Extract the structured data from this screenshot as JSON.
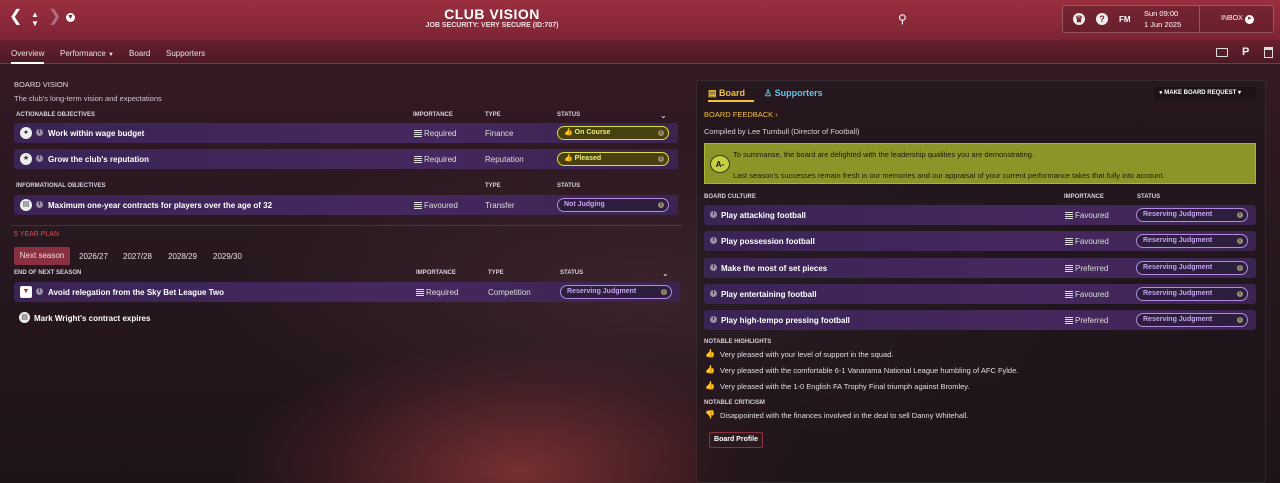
{
  "header": {
    "title": "CLUB VISION",
    "subtitle": "JOB SECURITY: VERY SECURE (ID:707)",
    "date": "Sun 09:00",
    "date2": "1 Jun 2025",
    "fm": "FM",
    "help": "?",
    "inbox": "INBOX"
  },
  "tabs": [
    "Overview",
    "Performance",
    "Board",
    "Supporters"
  ],
  "vision": {
    "heading": "BOARD VISION",
    "desc": "The club's long-term vision and expectations",
    "actionable": "ACTIONABLE OBJECTIVES",
    "informational": "INFORMATIONAL OBJECTIVES",
    "col_importance": "IMPORTANCE",
    "col_type": "TYPE",
    "col_status": "STATUS"
  },
  "actionable": [
    {
      "name": "Work within wage budget",
      "importance": "Required",
      "type": "Finance",
      "status": "On Course"
    },
    {
      "name": "Grow the club's reputation",
      "importance": "Required",
      "type": "Reputation",
      "status": "Pleased"
    }
  ],
  "informational": [
    {
      "name": "Maximum one-year contracts for players over the age of 32",
      "importance": "Favoured",
      "type": "Transfer",
      "status": "Not Judging"
    }
  ],
  "plan": {
    "heading": "5 YEAR PLAN",
    "years": [
      "Next season",
      "2026/27",
      "2027/28",
      "2028/29",
      "2029/30"
    ],
    "sub": "END OF NEXT SEASON",
    "item": {
      "name": "Avoid relegation from the Sky Bet League Two",
      "importance": "Required",
      "type": "Competition",
      "status": "Reserving Judgment"
    },
    "note": "Mark Wright's contract expires"
  },
  "right": {
    "tab_board": "Board",
    "tab_supporters": "Supporters",
    "request": "MAKE BOARD REQUEST",
    "feedback": "BOARD FEEDBACK",
    "compiled": "Compiled by Lee Turnbull (Director of Football)",
    "grade": "A-",
    "summary1": "To summarise, the board are delighted with the leadership qualities you are demonstrating.",
    "summary2": "Last season's successes remain fresh in our memories and our appraisal of your current performance takes that fully into account.",
    "culture": "BOARD CULTURE",
    "col_importance": "IMPORTANCE",
    "col_status": "STATUS",
    "culture_items": [
      {
        "name": "Play attacking football",
        "importance": "Favoured",
        "status": "Reserving Judgment"
      },
      {
        "name": "Play possession football",
        "importance": "Favoured",
        "status": "Reserving Judgment"
      },
      {
        "name": "Make the most of set pieces",
        "importance": "Preferred",
        "status": "Reserving Judgment"
      },
      {
        "name": "Play entertaining football",
        "importance": "Favoured",
        "status": "Reserving Judgment"
      },
      {
        "name": "Play high-tempo pressing football",
        "importance": "Preferred",
        "status": "Reserving Judgment"
      }
    ],
    "highlights_h": "NOTABLE HIGHLIGHTS",
    "highlights": [
      "Very pleased with your level of support in the squad.",
      "Very pleased with the comfortable 6-1 Vanarama National League humbling of AFC Fylde.",
      "Very pleased with the 1-0 English FA Trophy Final triumph against Bromley."
    ],
    "criticism_h": "NOTABLE CRITICISM",
    "criticism": [
      "Disappointed with the finances involved in the deal to sell Danny Whitehall."
    ],
    "profile": "Board Profile"
  },
  "colors": {
    "accent": "#9b2f40",
    "green_pill": "#d8e23a",
    "purple_pill": "#b58ae0",
    "feedback_box": "#8c9628"
  }
}
